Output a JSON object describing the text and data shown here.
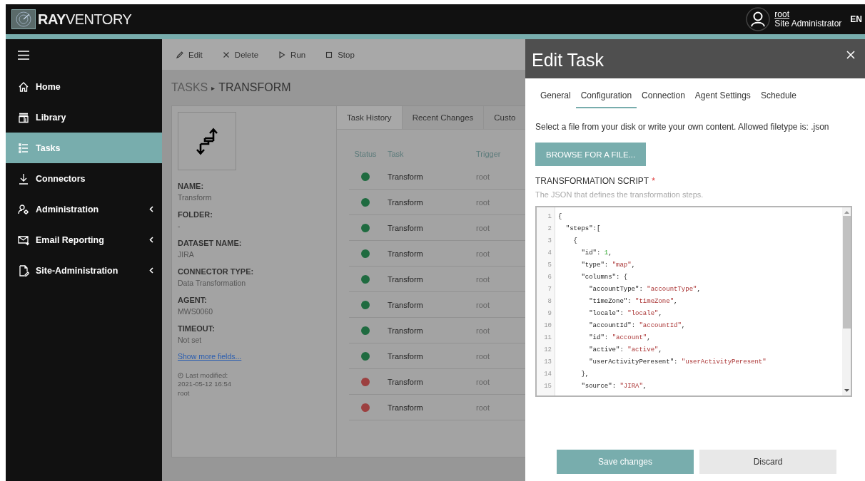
{
  "topbar": {
    "logo_text_bold": "RAY",
    "logo_text": "VENTORY",
    "user": {
      "name": "root",
      "role": "Site Administrator"
    },
    "language": "EN"
  },
  "sidebar": {
    "items": [
      {
        "label": "Home",
        "selected": false,
        "has_submenu": false
      },
      {
        "label": "Library",
        "selected": false,
        "has_submenu": false
      },
      {
        "label": "Tasks",
        "selected": true,
        "has_submenu": false
      },
      {
        "label": "Connectors",
        "selected": false,
        "has_submenu": false
      },
      {
        "label": "Administration",
        "selected": false,
        "has_submenu": true
      },
      {
        "label": "Email Reporting",
        "selected": false,
        "has_submenu": true
      },
      {
        "label": "Site-Administration",
        "selected": false,
        "has_submenu": true
      }
    ]
  },
  "toolbar": [
    {
      "label": "Edit"
    },
    {
      "label": "Delete"
    },
    {
      "label": "Run"
    },
    {
      "label": "Stop"
    }
  ],
  "breadcrumb": {
    "parent": "TASKS",
    "separator": "▸",
    "current": "TRANSFORM"
  },
  "details": {
    "fields": [
      {
        "label": "NAME:",
        "value": "Transform"
      },
      {
        "label": "FOLDER:",
        "value": "-"
      },
      {
        "label": "DATASET NAME:",
        "value": "JIRA"
      },
      {
        "label": "CONNECTOR TYPE:",
        "value": "Data Transformation"
      },
      {
        "label": "AGENT:",
        "value": "MWS0060"
      },
      {
        "label": "TIMEOUT:",
        "value": "Not set"
      }
    ],
    "more_link": "Show more fields...",
    "modified_label": "Last modified:",
    "modified_date": "2021-05-12 16:54",
    "modified_by": "root"
  },
  "history": {
    "tabs": [
      {
        "label": "Task History",
        "selected": true
      },
      {
        "label": "Recent Changes",
        "selected": false
      },
      {
        "label": "Custo",
        "selected": false
      }
    ],
    "columns": [
      "Status",
      "Task",
      "Trigger"
    ],
    "rows": [
      {
        "color": "#1f6b40",
        "task": "Transform",
        "trigger": "root"
      },
      {
        "color": "#1f6b40",
        "task": "Transform",
        "trigger": "root"
      },
      {
        "color": "#1f6b40",
        "task": "Transform",
        "trigger": "root"
      },
      {
        "color": "#1f6b40",
        "task": "Transform",
        "trigger": "root"
      },
      {
        "color": "#1f6b40",
        "task": "Transform",
        "trigger": "root"
      },
      {
        "color": "#1f6b40",
        "task": "Transform",
        "trigger": "root"
      },
      {
        "color": "#1f6b40",
        "task": "Transform",
        "trigger": "root"
      },
      {
        "color": "#1f6b40",
        "task": "Transform",
        "trigger": "root"
      },
      {
        "color": "#9c4040",
        "task": "Transform",
        "trigger": "root"
      },
      {
        "color": "#9c4040",
        "task": "Transform",
        "trigger": "root"
      }
    ]
  },
  "drawer": {
    "title": "Edit Task",
    "tabs": [
      {
        "label": "General",
        "selected": false
      },
      {
        "label": "Configuration",
        "selected": true
      },
      {
        "label": "Connection",
        "selected": false
      },
      {
        "label": "Agent Settings",
        "selected": false
      },
      {
        "label": "Schedule",
        "selected": false
      }
    ],
    "intro": "Select a file from your disk or write your own content. Allowed filetype is: .json",
    "browse_button": "BROWSE FOR A FILE...",
    "script_label": "TRANSFORMATION SCRIPT",
    "required_mark": "*",
    "script_hint": "The JSON that defines the transformation steps.",
    "code_lines": [
      {
        "number": "1",
        "tokens": [
          {
            "kind": "punct",
            "text": "{"
          }
        ]
      },
      {
        "number": "2",
        "tokens": [
          {
            "kind": "key",
            "text": "  \"steps\""
          },
          {
            "kind": "punct",
            "text": ":["
          }
        ]
      },
      {
        "number": "3",
        "tokens": [
          {
            "kind": "punct",
            "text": "    {"
          }
        ]
      },
      {
        "number": "4",
        "tokens": [
          {
            "kind": "key",
            "text": "      \"id\""
          },
          {
            "kind": "punct",
            "text": ": "
          },
          {
            "kind": "number",
            "text": "1"
          },
          {
            "kind": "punct",
            "text": ","
          }
        ]
      },
      {
        "number": "5",
        "tokens": [
          {
            "kind": "key",
            "text": "      \"type\""
          },
          {
            "kind": "punct",
            "text": ": "
          },
          {
            "kind": "string",
            "text": "\"map\""
          },
          {
            "kind": "punct",
            "text": ","
          }
        ]
      },
      {
        "number": "6",
        "tokens": [
          {
            "kind": "key",
            "text": "      \"columns\""
          },
          {
            "kind": "punct",
            "text": ": {"
          }
        ]
      },
      {
        "number": "7",
        "tokens": [
          {
            "kind": "key",
            "text": "        \"accountType\""
          },
          {
            "kind": "punct",
            "text": ": "
          },
          {
            "kind": "string",
            "text": "\"accountType\""
          },
          {
            "kind": "punct",
            "text": ","
          }
        ]
      },
      {
        "number": "8",
        "tokens": [
          {
            "kind": "key",
            "text": "        \"timeZone\""
          },
          {
            "kind": "punct",
            "text": ": "
          },
          {
            "kind": "string",
            "text": "\"timeZone\""
          },
          {
            "kind": "punct",
            "text": ","
          }
        ]
      },
      {
        "number": "9",
        "tokens": [
          {
            "kind": "key",
            "text": "        \"locale\""
          },
          {
            "kind": "punct",
            "text": ": "
          },
          {
            "kind": "string",
            "text": "\"locale\""
          },
          {
            "kind": "punct",
            "text": ","
          }
        ]
      },
      {
        "number": "10",
        "tokens": [
          {
            "kind": "key",
            "text": "        \"accountId\""
          },
          {
            "kind": "punct",
            "text": ": "
          },
          {
            "kind": "string",
            "text": "\"accountId\""
          },
          {
            "kind": "punct",
            "text": ","
          }
        ]
      },
      {
        "number": "11",
        "tokens": [
          {
            "kind": "key",
            "text": "        \"id\""
          },
          {
            "kind": "punct",
            "text": ": "
          },
          {
            "kind": "string",
            "text": "\"account\""
          },
          {
            "kind": "punct",
            "text": ","
          }
        ]
      },
      {
        "number": "12",
        "tokens": [
          {
            "kind": "key",
            "text": "        \"active\""
          },
          {
            "kind": "punct",
            "text": ": "
          },
          {
            "kind": "string",
            "text": "\"active\""
          },
          {
            "kind": "punct",
            "text": ","
          }
        ]
      },
      {
        "number": "13",
        "tokens": [
          {
            "kind": "key",
            "text": "        \"userActivityPeresent\""
          },
          {
            "kind": "punct",
            "text": ": "
          },
          {
            "kind": "string",
            "text": "\"userActivityPeresent\""
          }
        ]
      },
      {
        "number": "14",
        "tokens": [
          {
            "kind": "punct",
            "text": "      },"
          }
        ]
      },
      {
        "number": "15",
        "tokens": [
          {
            "kind": "key",
            "text": "      \"source\""
          },
          {
            "kind": "punct",
            "text": ": "
          },
          {
            "kind": "string",
            "text": "\"JIRA\""
          },
          {
            "kind": "punct",
            "text": ","
          }
        ]
      }
    ],
    "save_button": "Save changes",
    "discard_button": "Discard"
  }
}
